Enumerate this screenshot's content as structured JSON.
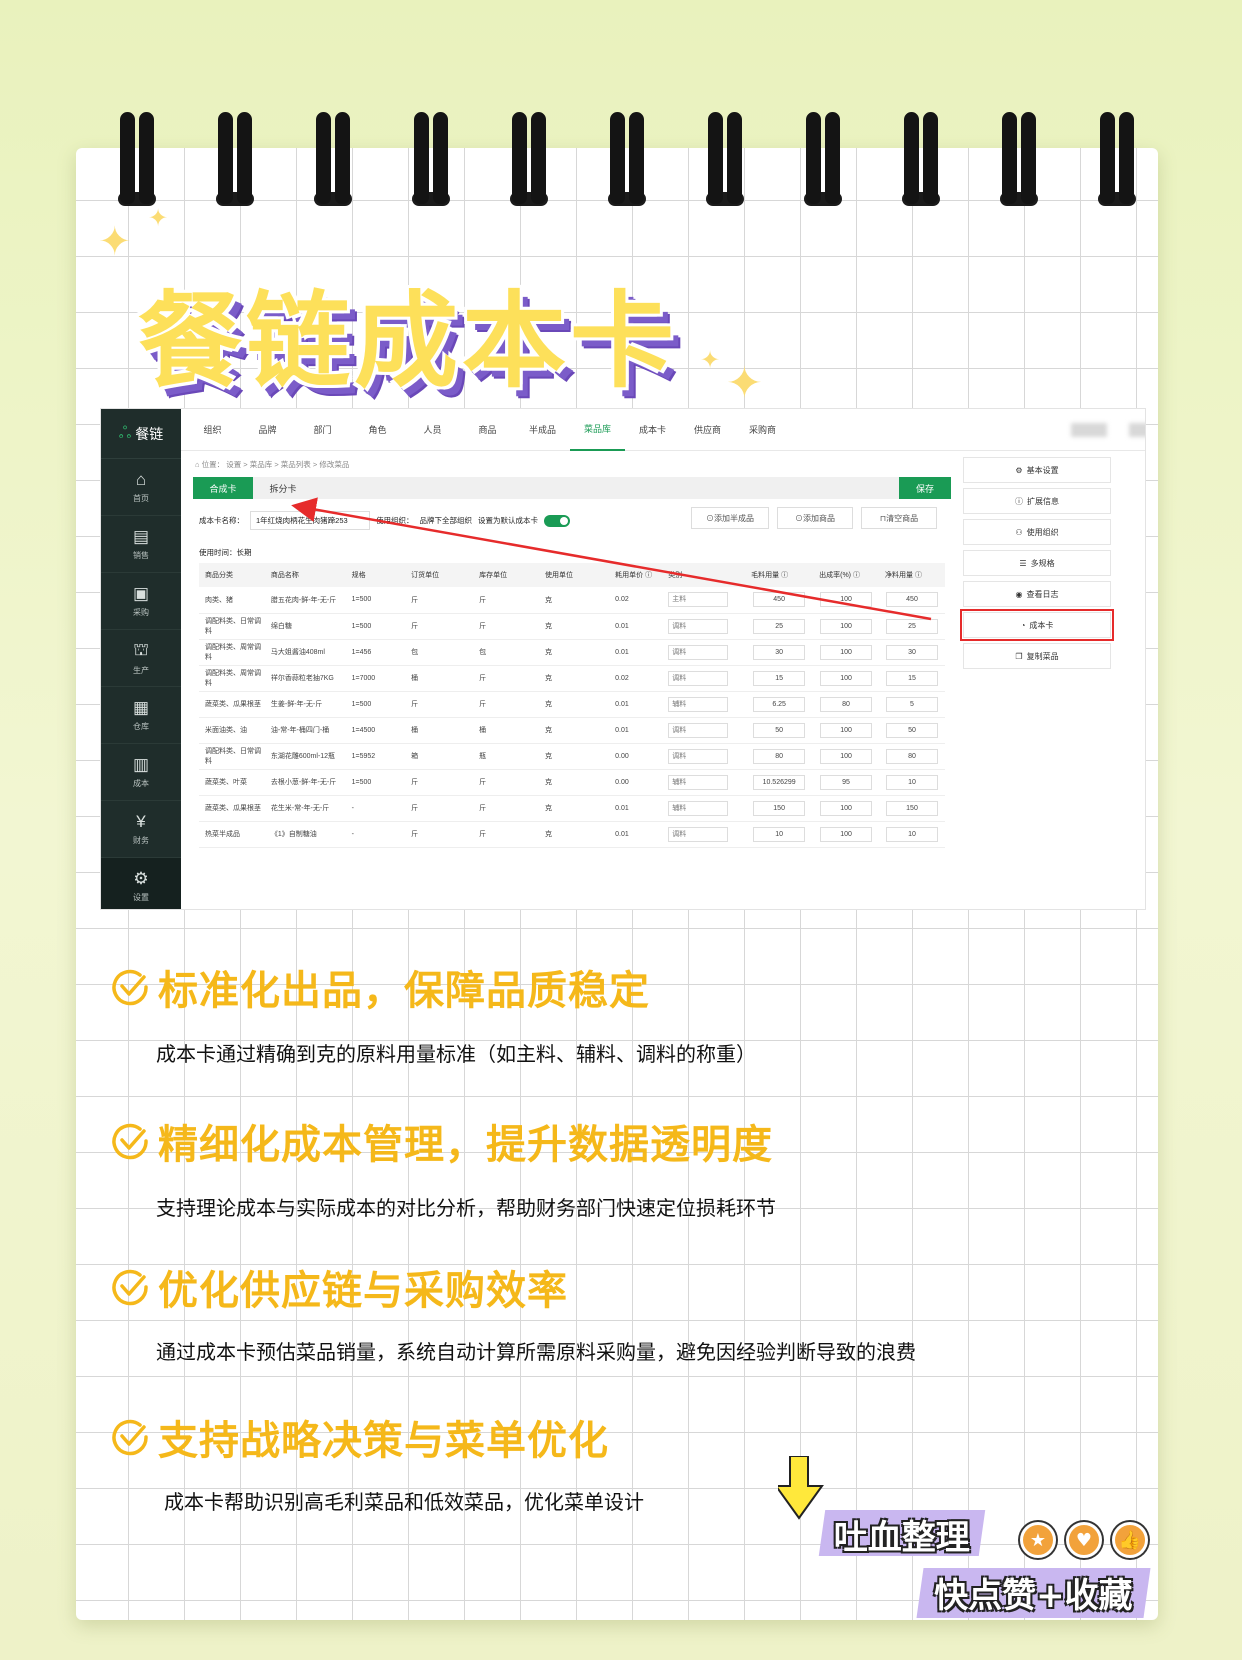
{
  "title": "餐链成本卡",
  "app": {
    "logo": "餐链",
    "side_nav": [
      {
        "label": "首页",
        "icon": "home-icon"
      },
      {
        "label": "销售",
        "icon": "wallet-icon"
      },
      {
        "label": "采购",
        "icon": "cart-icon"
      },
      {
        "label": "生产",
        "icon": "factory-icon"
      },
      {
        "label": "仓库",
        "icon": "box-icon"
      },
      {
        "label": "成本",
        "icon": "cost-icon"
      },
      {
        "label": "财务",
        "icon": "finance-icon"
      },
      {
        "label": "设置",
        "icon": "gear-icon"
      }
    ],
    "top_nav": [
      "组织",
      "品牌",
      "部门",
      "角色",
      "人员",
      "商品",
      "半成品",
      "菜品库",
      "成本卡",
      "供应商",
      "采购商"
    ],
    "top_nav_active": "菜品库",
    "breadcrumb": "⌂ 位置： 设置 > 菜品库 > 菜品列表 > 修改菜品",
    "tabs": [
      "合成卡",
      "拆分卡"
    ],
    "save_label": "保存",
    "card_name_label": "成本卡名称：",
    "card_name_value": "1年红烧肉柄花生肉猪蹄253",
    "org_label": "使用组织：",
    "org_value": "品牌下全部组织",
    "default_label": "设置为默认成本卡",
    "use_time": "使用时间：长期",
    "action_buttons": [
      "⊙添加半成品",
      "⊙添加商品",
      "⊓清空商品"
    ],
    "columns": [
      "商品分类",
      "商品名称",
      "规格",
      "订货单位",
      "库存单位",
      "使用单位",
      "耗用单价 ⓘ",
      "类别",
      "毛料用量 ⓘ",
      "出成率(%) ⓘ",
      "净料用量 ⓘ"
    ],
    "rows": [
      {
        "cat": "肉类、猪",
        "name": "腊五花肉-鲜-年-无-斤",
        "spec": "1=500",
        "order": "斤",
        "stock": "斤",
        "use": "克",
        "price": "0.02",
        "type": "主料",
        "gross": "450",
        "yield": "100",
        "net": "450"
      },
      {
        "cat": "调配料类、日常调料",
        "name": "绵白糖",
        "spec": "1=500",
        "order": "斤",
        "stock": "斤",
        "use": "克",
        "price": "0.01",
        "type": "调料",
        "gross": "25",
        "yield": "100",
        "net": "25"
      },
      {
        "cat": "调配料类、周常调料",
        "name": "马大姐酱油408ml",
        "spec": "1=456",
        "order": "包",
        "stock": "包",
        "use": "克",
        "price": "0.01",
        "type": "调料",
        "gross": "30",
        "yield": "100",
        "net": "30"
      },
      {
        "cat": "调配料类、周常调料",
        "name": "祥尔香蒜粒老抽7KG",
        "spec": "1=7000",
        "order": "桶",
        "stock": "斤",
        "use": "克",
        "price": "0.02",
        "type": "调料",
        "gross": "15",
        "yield": "100",
        "net": "15"
      },
      {
        "cat": "蔬菜类、瓜果根茎",
        "name": "生姜-鲜-年-无-斤",
        "spec": "1=500",
        "order": "斤",
        "stock": "斤",
        "use": "克",
        "price": "0.01",
        "type": "辅料",
        "gross": "6.25",
        "yield": "80",
        "net": "5"
      },
      {
        "cat": "米面油类、油",
        "name": "油-常-年-桶四门-桶",
        "spec": "1=4500",
        "order": "桶",
        "stock": "桶",
        "use": "克",
        "price": "0.01",
        "type": "调料",
        "gross": "50",
        "yield": "100",
        "net": "50"
      },
      {
        "cat": "调配料类、日常调料",
        "name": "东湖花雕600ml-12瓶",
        "spec": "1=5952",
        "order": "箱",
        "stock": "瓶",
        "use": "克",
        "price": "0.00",
        "type": "调料",
        "gross": "80",
        "yield": "100",
        "net": "80"
      },
      {
        "cat": "蔬菜类、叶菜",
        "name": "去根小葱-鲜-年-无-斤",
        "spec": "1=500",
        "order": "斤",
        "stock": "斤",
        "use": "克",
        "price": "0.00",
        "type": "辅料",
        "gross": "10.526299",
        "yield": "95",
        "net": "10"
      },
      {
        "cat": "蔬菜类、瓜果根茎",
        "name": "花生米-常-年-无-斤",
        "spec": "-",
        "order": "斤",
        "stock": "斤",
        "use": "克",
        "price": "0.01",
        "type": "辅料",
        "gross": "150",
        "yield": "100",
        "net": "150"
      },
      {
        "cat": "热菜半成品",
        "name": "《1》自制糖油",
        "spec": "-",
        "order": "斤",
        "stock": "斤",
        "use": "克",
        "price": "0.01",
        "type": "调料",
        "gross": "10",
        "yield": "100",
        "net": "10"
      }
    ],
    "right_buttons": [
      {
        "label": "基本设置",
        "icon": "gear-icon"
      },
      {
        "label": "扩展信息",
        "icon": "info-icon"
      },
      {
        "label": "使用组织",
        "icon": "org-icon"
      },
      {
        "label": "多规格",
        "icon": "list-icon"
      },
      {
        "label": "查看日志",
        "icon": "eye-icon"
      },
      {
        "label": "成本卡",
        "icon": "pie-icon"
      },
      {
        "label": "复制菜品",
        "icon": "copy-icon"
      }
    ]
  },
  "sections": [
    {
      "heading": "标准化出品，保障品质稳定",
      "desc": "成本卡通过精确到克的原料用量标准（如主料、辅料、调料的称重）"
    },
    {
      "heading": "精细化成本管理，提升数据透明度",
      "desc": "支持理论成本与实际成本的对比分析，帮助财务部门快速定位损耗环节"
    },
    {
      "heading": "优化供应链与采购效率",
      "desc": "通过成本卡预估菜品销量，系统自动计算所需原料采购量，避免因经验判断导致的浪费"
    },
    {
      "heading": "支持战略决策与菜单优化",
      "desc": "成本卡帮助识别高毛利菜品和低效菜品，优化菜单设计"
    }
  ],
  "promo": {
    "line1": "吐血整理",
    "line2": "快点赞+收藏"
  },
  "colors": {
    "accent_green": "#1a9b55",
    "heading_orange": "#f5b81a",
    "title_yellow": "#fde05a",
    "title_purple": "#7b5cc9",
    "highlight_red": "#e62b2b"
  }
}
